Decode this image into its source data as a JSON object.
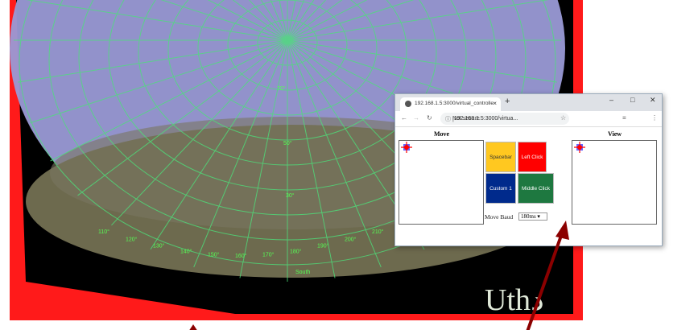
{
  "game": {
    "labels": [
      "50°",
      "70°",
      "30°",
      "South",
      "110°",
      "120°",
      "130°",
      "140°",
      "150°",
      "160°",
      "170°",
      "180°",
      "190°",
      "200°",
      "210°"
    ],
    "colors": {
      "frame": "#ff1a1a",
      "dome": "#9a9ad6",
      "grid": "#4de07a",
      "terrain": "#6d6a4e"
    }
  },
  "browser": {
    "tab_title": "192.168.1.5:3000/virtual_controlle",
    "new_tab": "+",
    "security": "Not secure",
    "url": "192.168.1.5:3000/virtua...",
    "move_label": "Move",
    "view_label": "View",
    "buttons": [
      {
        "label": "Spacebar",
        "color": "#ffc820"
      },
      {
        "label": "Left Click",
        "color": "#ff0000"
      },
      {
        "label": "Custom 1",
        "color": "#002a8c"
      },
      {
        "label": "Middle Click",
        "color": "#1e7840"
      }
    ],
    "baud_label": "Move Baud",
    "baud_value": "180ms ▾"
  },
  "annotation": {
    "arrow_color": "#8b0000"
  }
}
